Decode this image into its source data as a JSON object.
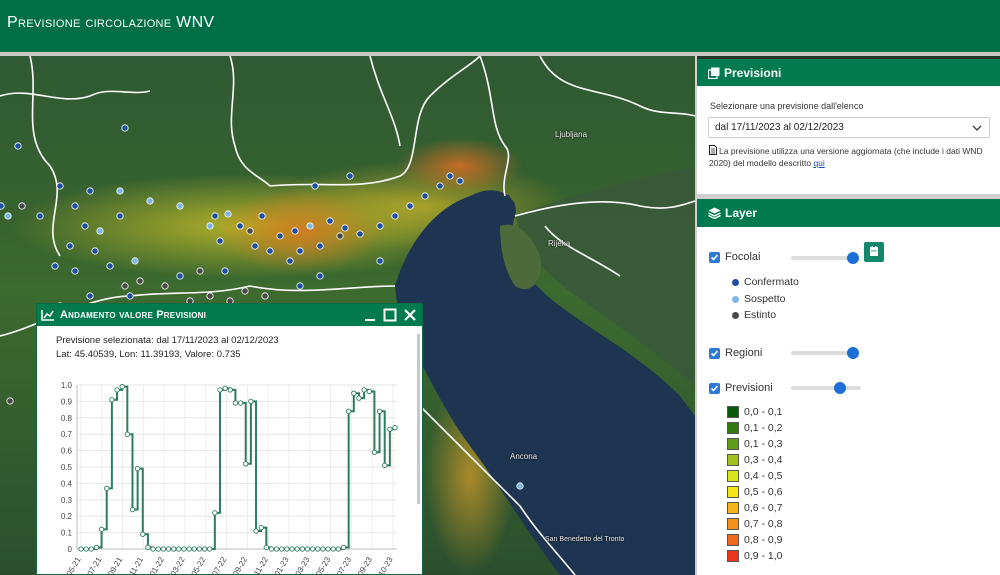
{
  "header": {
    "title": "Previsione circolazione WNV"
  },
  "map": {
    "places": [
      "Ljubljana",
      "Rijeka",
      "Ancona",
      "San Benedetto del Tronto"
    ]
  },
  "chart_popup": {
    "title": "Andamento valore Previsioni",
    "selected_line": "Previsione selezionata: dal 17/11/2023 al 02/12/2023",
    "coords_line": "Lat: 45.40539, Lon: 11.39193, Valore: 0.735",
    "chart_data": {
      "type": "line",
      "ylim": [
        0,
        1.0
      ],
      "yticks": [
        "1.0",
        "0.9",
        "0.8",
        "0.7",
        "0.6",
        "0.5",
        "0.4",
        "0.3",
        "0.2",
        "0.1",
        "0"
      ],
      "xticks": [
        "05-21",
        "07-21",
        "09-21",
        "11-21",
        "01-22",
        "03-22",
        "05-22",
        "07-22",
        "09-22",
        "11-22",
        "01-23",
        "03-23",
        "05-23",
        "07-23",
        "09-23",
        "10-23"
      ],
      "series": [
        {
          "color": "#2e7d5e",
          "step": true,
          "values": [
            0,
            0,
            0,
            0.01,
            0.12,
            0.37,
            0.91,
            0.97,
            0.99,
            0.7,
            0.24,
            0.49,
            0.09,
            0.01,
            0,
            0,
            0,
            0,
            0,
            0,
            0,
            0,
            0,
            0,
            0,
            0,
            0.22,
            0.97,
            0.98,
            0.97,
            0.89,
            0.89,
            0.52,
            0.9,
            0.11,
            0.13,
            0.01,
            0,
            0,
            0,
            0,
            0,
            0,
            0,
            0,
            0,
            0,
            0,
            0,
            0,
            0,
            0.01,
            0.84,
            0.95,
            0.92,
            0.97,
            0.96,
            0.59,
            0.84,
            0.51,
            0.73,
            0.74
          ]
        }
      ]
    }
  },
  "previsioni_panel": {
    "title": "Previsioni",
    "select_label": "Selezionare una previsione dall'elenco",
    "selected_value": "dal 17/11/2023 al 02/12/2023",
    "note_text": "La previsione utilizza una versione aggiornata (che include i dati WND 2020) del modello descritto",
    "note_link": "qui"
  },
  "layer_panel": {
    "title": "Layer",
    "layers": [
      {
        "name": "Focolai",
        "checked": true,
        "opacity": 0.94
      },
      {
        "name": "Regioni",
        "checked": true,
        "opacity": 0.94
      },
      {
        "name": "Previsioni",
        "checked": true,
        "opacity": 0.71
      }
    ],
    "focolai_legend": [
      {
        "label": "Confermato",
        "color": "#1f4fa0"
      },
      {
        "label": "Sospetto",
        "color": "#7fb4e6"
      },
      {
        "label": "Estinto",
        "color": "#4a4a4a"
      }
    ],
    "scale": [
      {
        "label": "0,0 - 0,1",
        "color": "#0b5a0b"
      },
      {
        "label": "0,1 - 0,2",
        "color": "#2f7a12"
      },
      {
        "label": "0,1 - 0,3",
        "color": "#5f9a1c"
      },
      {
        "label": "0,3 - 0,4",
        "color": "#a3c01f"
      },
      {
        "label": "0,4 - 0,5",
        "color": "#d6e51e"
      },
      {
        "label": "0,5 - 0,6",
        "color": "#f7e51a"
      },
      {
        "label": "0,6 - 0,7",
        "color": "#f5b51b"
      },
      {
        "label": "0,7 - 0,8",
        "color": "#f1921c"
      },
      {
        "label": "0,8 - 0,9",
        "color": "#ec6a1e"
      },
      {
        "label": "0,9 - 1,0",
        "color": "#e8361f"
      }
    ]
  }
}
